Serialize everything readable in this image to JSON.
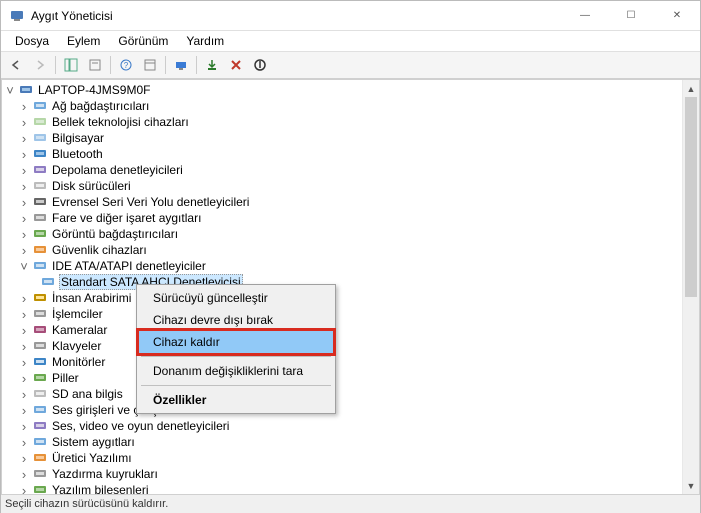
{
  "window": {
    "title": "Aygıt Yöneticisi"
  },
  "menu": {
    "file": "Dosya",
    "action": "Eylem",
    "view": "Görünüm",
    "help": "Yardım"
  },
  "tree": {
    "root": "LAPTOP-4JMS9M0F",
    "categories": [
      "Ağ bağdaştırıcıları",
      "Bellek teknolojisi cihazları",
      "Bilgisayar",
      "Bluetooth",
      "Depolama denetleyicileri",
      "Disk sürücüleri",
      "Evrensel Seri Veri Yolu denetleyicileri",
      "Fare ve diğer işaret aygıtları",
      "Görüntü bağdaştırıcıları",
      "Güvenlik cihazları",
      "IDE ATA/ATAPI denetleyiciler",
      "İnsan Arabirimi",
      "İşlemciler",
      "Kameralar",
      "Klavyeler",
      "Monitörler",
      "Piller",
      "SD ana bilgis",
      "Ses girişleri ve çıkışları",
      "Ses, video ve oyun denetleyicileri",
      "Sistem aygıtları",
      "Üretici Yazılımı",
      "Yazdırma kuyrukları",
      "Yazılım bileşenleri"
    ],
    "selected_device": "Standart SATA AHCI Denetleyicisi"
  },
  "context_menu": {
    "update_driver": "Sürücüyü güncelleştir",
    "disable": "Cihazı devre dışı bırak",
    "uninstall": "Cihazı kaldır",
    "scan": "Donanım değişikliklerini tara",
    "properties": "Özellikler"
  },
  "status": "Seçili cihazın sürücüsünü kaldırır."
}
